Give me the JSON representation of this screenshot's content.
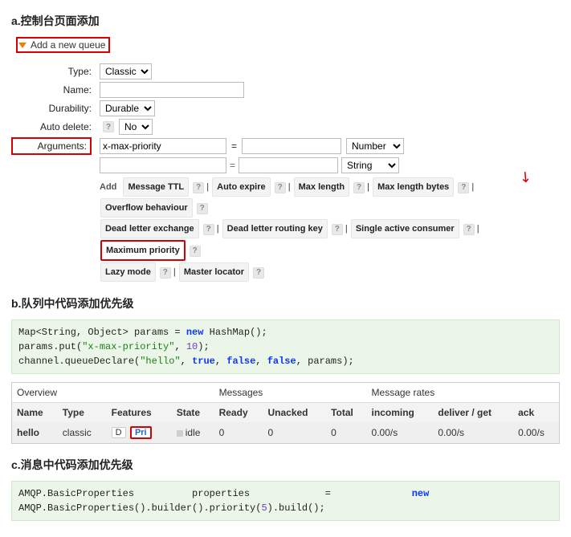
{
  "section_a": {
    "title": "a.控制台页面添加",
    "collapse_header": "Add a new queue",
    "form": {
      "type_label": "Type:",
      "type_value": "Classic",
      "name_label": "Name:",
      "name_value": "",
      "durability_label": "Durability:",
      "durability_value": "Durable",
      "autodelete_label": "Auto delete:",
      "autodelete_value": "No",
      "arguments_label": "Arguments:"
    },
    "arguments": {
      "row0": {
        "key": "x-max-priority",
        "value": "",
        "type": "Number"
      },
      "row1": {
        "key": "",
        "value": "",
        "type": "String"
      }
    },
    "add_label": "Add",
    "arg_tags": {
      "message_ttl": "Message TTL",
      "auto_expire": "Auto expire",
      "max_length": "Max length",
      "max_bytes": "Max length bytes",
      "overflow": "Overflow behaviour",
      "dlx": "Dead letter exchange",
      "dlrk": "Dead letter routing key",
      "sac": "Single active consumer",
      "max_priority": "Maximum priority",
      "lazy": "Lazy mode",
      "master": "Master locator"
    }
  },
  "section_b": {
    "title": "b.队列中代码添加优先级",
    "code": {
      "l1a": "Map<String, Object> params = ",
      "l1_new": "new",
      "l1b": " HashMap();",
      "l2a": "params.put(",
      "l2_s": "\"x-max-priority\"",
      "l2b": ", ",
      "l2_n": "10",
      "l2c": ");",
      "l3a": "channel.queueDeclare(",
      "l3_s": "\"hello\"",
      "l3b": ", ",
      "l3_t": "true",
      "l3c": ", ",
      "l3_f1": "false",
      "l3d": ", ",
      "l3_f2": "false",
      "l3e": ", params);"
    },
    "table": {
      "group_overview": "Overview",
      "group_messages": "Messages",
      "group_rates": "Message rates",
      "col_name": "Name",
      "col_type": "Type",
      "col_features": "Features",
      "col_state": "State",
      "col_ready": "Ready",
      "col_unacked": "Unacked",
      "col_total": "Total",
      "col_in": "incoming",
      "col_dg": "deliver / get",
      "col_ack": "ack",
      "row": {
        "name": "hello",
        "type": "classic",
        "feat_d": "D",
        "feat_pri": "Pri",
        "state": "idle",
        "ready": "0",
        "unacked": "0",
        "total": "0",
        "incoming": "0.00/s",
        "deliver": "0.00/s",
        "ack": "0.00/s"
      }
    }
  },
  "section_c": {
    "title": "c.消息中代码添加优先级",
    "code": {
      "l1a": "AMQP.BasicProperties          properties             =              ",
      "l1_new": "new",
      "l2a": "AMQP.BasicProperties().builder().priority(",
      "l2_n": "5",
      "l2b": ").build();"
    }
  },
  "help": "?"
}
